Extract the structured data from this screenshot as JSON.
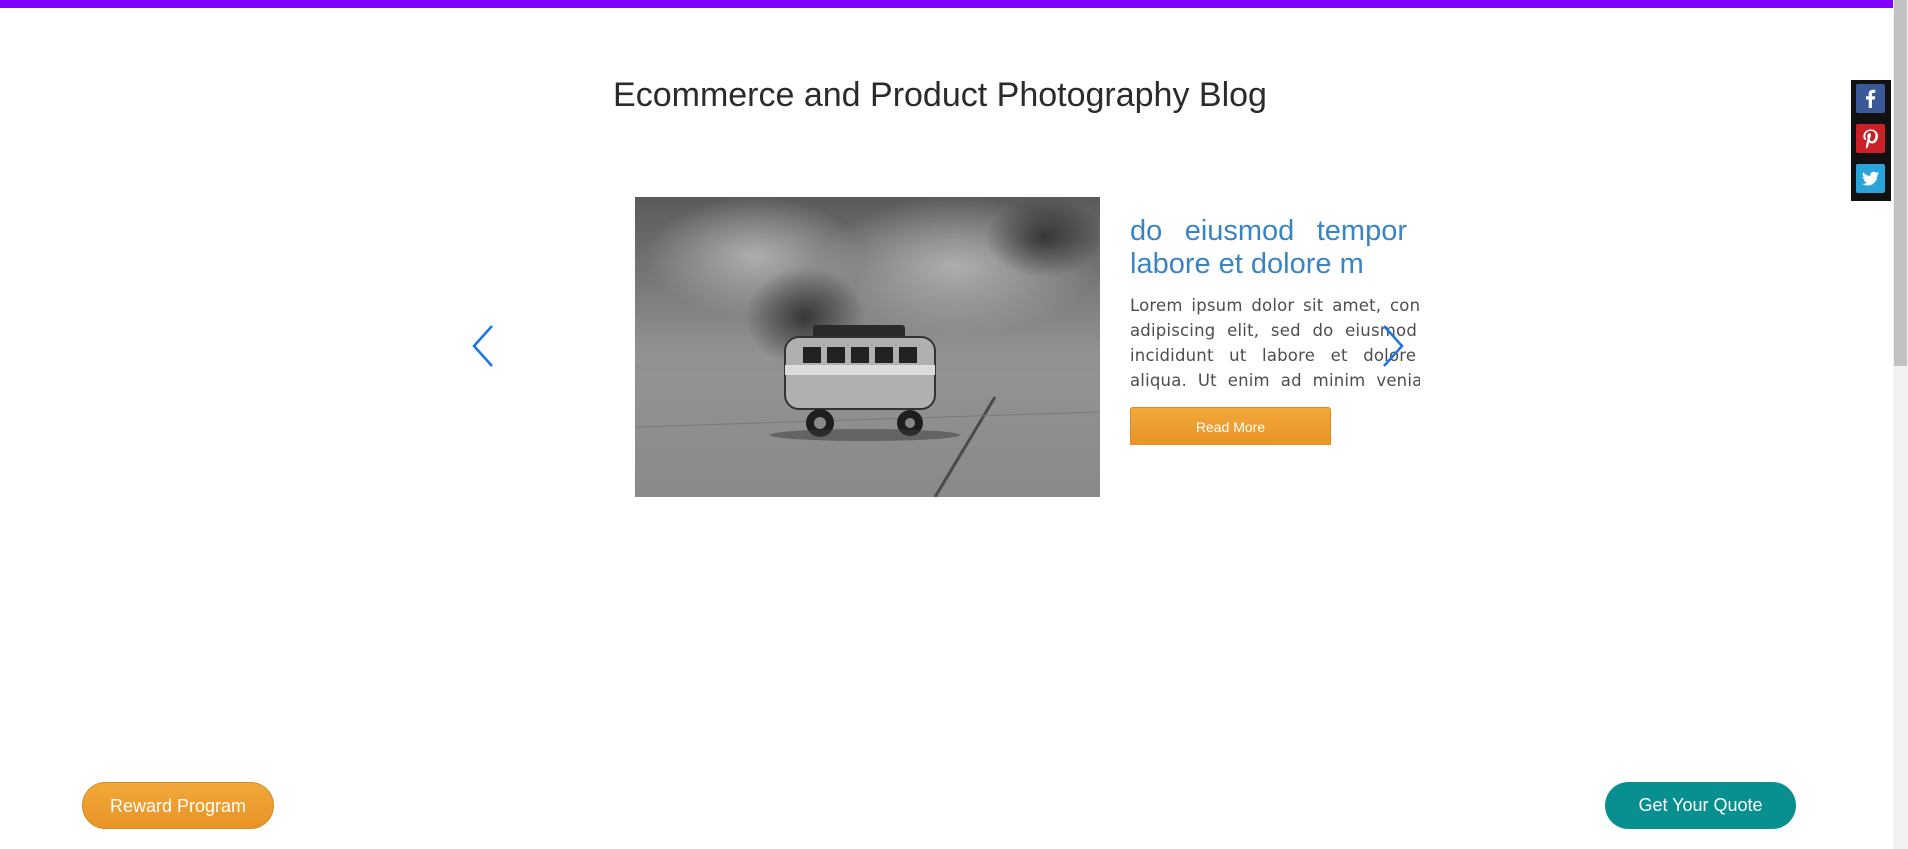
{
  "page": {
    "title": "Ecommerce and Product Photography Blog"
  },
  "colors": {
    "top_bar": "#8000ff",
    "accent_orange": "#f0a030",
    "accent_teal": "#07908f",
    "post_title": "#3a84c4",
    "arrow": "#1a73e8"
  },
  "carousel": {
    "prev_icon": "chevron-left-icon",
    "next_icon": "chevron-right-icon",
    "slide": {
      "image_subject": "black-and-white toy van photo",
      "title": "do eiusmod tempor labore et dolore m",
      "excerpt": "Lorem ipsum dolor sit amet, consectetur adipiscing elit, sed do eiusmod tempor incididunt ut labore et dolore magna aliqua. Ut enim ad minim veniam, quis nostrud exercitation ullamco laboris nisi ut aliquip ex ea commodo",
      "read_more_label": "Read More"
    }
  },
  "social": {
    "items": [
      {
        "name": "facebook",
        "icon": "facebook-icon"
      },
      {
        "name": "pinterest",
        "icon": "pinterest-icon"
      },
      {
        "name": "twitter",
        "icon": "twitter-icon"
      }
    ]
  },
  "footer_buttons": {
    "reward_label": "Reward Program",
    "quote_label": "Get Your Quote"
  }
}
